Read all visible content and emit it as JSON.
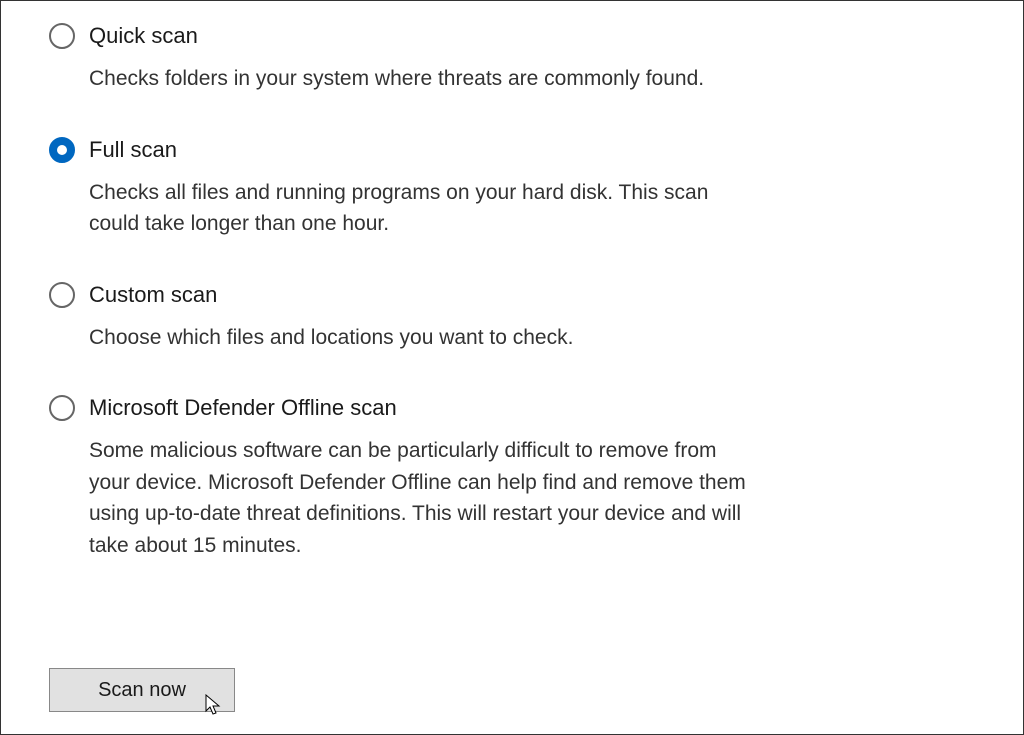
{
  "options": {
    "quick": {
      "title": "Quick scan",
      "desc": "Checks folders in your system where threats are commonly found.",
      "selected": false
    },
    "full": {
      "title": "Full scan",
      "desc": "Checks all files and running programs on your hard disk. This scan could take longer than one hour.",
      "selected": true
    },
    "custom": {
      "title": "Custom scan",
      "desc": "Choose which files and locations you want to check.",
      "selected": false
    },
    "offline": {
      "title": "Microsoft Defender Offline scan",
      "desc": "Some malicious software can be particularly difficult to remove from your device. Microsoft Defender Offline can help find and remove them using up-to-date threat definitions. This will restart your device and will take about 15 minutes.",
      "selected": false
    }
  },
  "button": {
    "scan_now": "Scan now"
  }
}
